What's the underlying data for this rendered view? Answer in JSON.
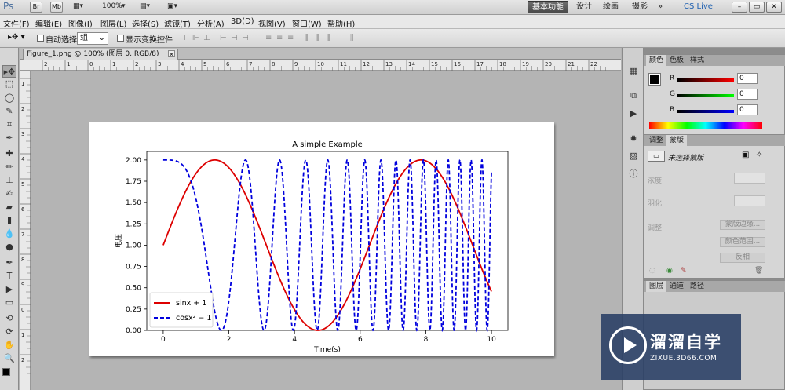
{
  "titlebar": {
    "app_logo": "Ps",
    "launch_bridge": "Br",
    "launch_minibridge": "Mb",
    "zoom_level": "100%",
    "workspaces": [
      "基本功能",
      "设计",
      "绘画",
      "摄影"
    ],
    "more": "»",
    "cs_live": "CS Live",
    "window_controls": [
      "–",
      "▭",
      "✕"
    ]
  },
  "menubar": {
    "items": [
      "文件(F)",
      "编辑(E)",
      "图像(I)",
      "图层(L)",
      "选择(S)",
      "滤镜(T)",
      "分析(A)",
      "3D(D)",
      "视图(V)",
      "窗口(W)",
      "帮助(H)"
    ]
  },
  "options": {
    "auto_select_label": "自动选择:",
    "auto_select_value": "组",
    "show_transform_label": "显示变换控件"
  },
  "document": {
    "tab_title": "Figure_1.png @ 100% (图层 0, RGB/8)",
    "ruler_labels": [
      "2",
      "1",
      "0",
      "1",
      "2",
      "3",
      "4",
      "5",
      "6",
      "7",
      "8",
      "9",
      "10",
      "11",
      "12",
      "13",
      "14",
      "15",
      "16",
      "17",
      "18",
      "19",
      "20",
      "21",
      "22"
    ],
    "ruler_v_labels": [
      "1",
      "2",
      "3",
      "4",
      "5",
      "6",
      "7",
      "8",
      "9",
      "0",
      "1",
      "2"
    ]
  },
  "panels": {
    "color_tabs": [
      "颜色",
      "色板",
      "样式"
    ],
    "color_channels": [
      {
        "label": "R",
        "value": "0",
        "color": "#cc0000"
      },
      {
        "label": "G",
        "value": "0",
        "color": "#00a000"
      },
      {
        "label": "B",
        "value": "0",
        "color": "#0000cc"
      }
    ],
    "adjust_tabs": [
      "调整",
      "蒙版",
      ""
    ],
    "mask_title": "未选择蒙版",
    "density_label": "浓度:",
    "feather_label": "羽化:",
    "refine_label": "调整:",
    "mask_edge_button": "蒙版边缘...",
    "color_range_button": "颜色范围...",
    "invert_button": "反相",
    "layers_tabs": [
      "图层",
      "通道",
      "路径"
    ]
  },
  "watermark": {
    "title": "溜溜自学",
    "url": "ZIXUE.3D66.COM"
  },
  "chart_data": {
    "type": "line",
    "title": "A simple Example",
    "xlabel": "Time(s)",
    "ylabel": "电压",
    "xlim": [
      -0.5,
      10.5
    ],
    "ylim": [
      0,
      2.1
    ],
    "xticks": [
      0,
      2,
      4,
      6,
      8,
      10
    ],
    "yticks": [
      0,
      0.25,
      0.5,
      0.75,
      1.0,
      1.25,
      1.5,
      1.75,
      2.0
    ],
    "x_range": [
      0,
      10
    ],
    "legend_position": "lower left",
    "series": [
      {
        "name": "sinx + 1",
        "function": "sin(x) + 1",
        "color": "#dd0000",
        "style": "solid"
      },
      {
        "name": "cosx² − 1",
        "function": "cos(x^2) + 1",
        "color": "#0000dd",
        "style": "dashed"
      }
    ],
    "grid": false
  }
}
